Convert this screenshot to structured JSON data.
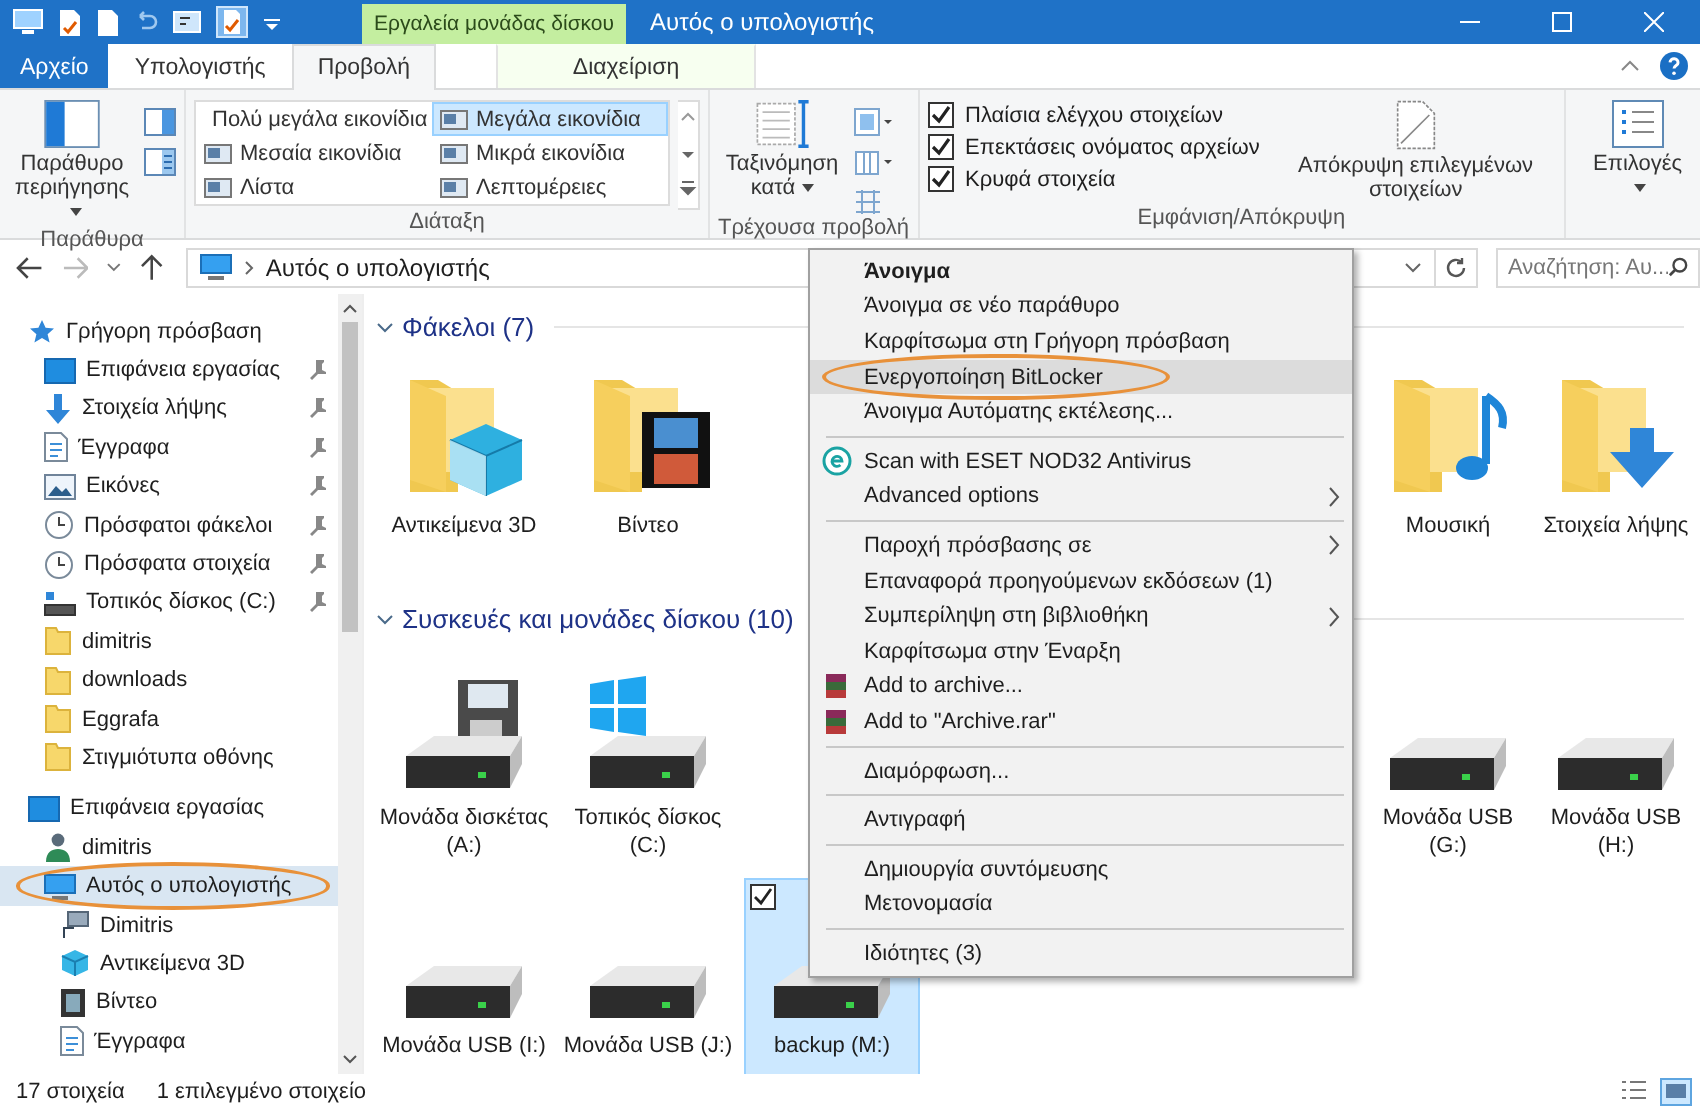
{
  "window": {
    "title": "Αυτός ο υπολογιστής",
    "context_tab": "Εργαλεία μονάδας δίσκου"
  },
  "tabs": [
    {
      "label": "Αρχείο",
      "kind": "file",
      "selected": false
    },
    {
      "label": "Υπολογιστής",
      "kind": "tab",
      "selected": false
    },
    {
      "label": "Προβολή",
      "kind": "tab",
      "selected": true
    },
    {
      "label": "Διαχείριση",
      "kind": "context",
      "selected": false
    }
  ],
  "ribbon": {
    "panes": {
      "button": "Παράθυρο περιήγησης",
      "label": "Παράθυρα"
    },
    "layout": {
      "label": "Διάταξη",
      "options": [
        {
          "label": "Πολύ μεγάλα εικονίδια",
          "selected": false
        },
        {
          "label": "Μεγάλα εικονίδια",
          "selected": true
        },
        {
          "label": "Μεσαία εικονίδια",
          "selected": false
        },
        {
          "label": "Μικρά εικονίδια",
          "selected": false
        },
        {
          "label": "Λίστα",
          "selected": false
        },
        {
          "label": "Λεπτομέρειες",
          "selected": false
        }
      ]
    },
    "current_view": {
      "button": "Ταξινόμηση κατά",
      "label": "Τρέχουσα προβολή"
    },
    "show_hide": {
      "label": "Εμφάνιση/Απόκρυψη",
      "checkboxes": [
        {
          "label": "Πλαίσια ελέγχου στοιχείων",
          "checked": true
        },
        {
          "label": "Επεκτάσεις ονόματος αρχείων",
          "checked": true
        },
        {
          "label": "Κρυφά στοιχεία",
          "checked": true
        }
      ],
      "hide_button": "Απόκρυψη επιλεγμένων στοιχείων"
    },
    "options": {
      "button": "Επιλογές"
    }
  },
  "address_bar": {
    "path": "Αυτός ο υπολογιστής",
    "search_placeholder": "Αναζήτηση: Αυ..."
  },
  "sidebar": {
    "items": [
      {
        "label": "Γρήγορη πρόσβαση",
        "kind": "star",
        "pinned": false,
        "selected": false,
        "circled": false,
        "children": [
          {
            "label": "Επιφάνεια εργασίας",
            "kind": "desktop",
            "pinned": true,
            "selected": false,
            "circled": false
          },
          {
            "label": "Στοιχεία λήψης",
            "kind": "download",
            "pinned": true,
            "selected": false,
            "circled": false
          },
          {
            "label": "Έγγραφα",
            "kind": "documents",
            "pinned": true,
            "selected": false,
            "circled": false
          },
          {
            "label": "Εικόνες",
            "kind": "pictures",
            "pinned": true,
            "selected": false,
            "circled": false
          },
          {
            "label": "Πρόσφατοι φάκελοι",
            "kind": "recent",
            "pinned": true,
            "selected": false,
            "circled": false
          },
          {
            "label": "Πρόσφατα στοιχεία",
            "kind": "recent",
            "pinned": true,
            "selected": false,
            "circled": false
          },
          {
            "label": "Τοπικός δίσκος (C:)",
            "kind": "drive",
            "pinned": true,
            "selected": false,
            "circled": false
          },
          {
            "label": "dimitris",
            "kind": "folder",
            "pinned": false,
            "selected": false,
            "circled": false
          },
          {
            "label": "downloads",
            "kind": "folder",
            "pinned": false,
            "selected": false,
            "circled": false
          },
          {
            "label": "Eggrafa",
            "kind": "folder",
            "pinned": false,
            "selected": false,
            "circled": false
          },
          {
            "label": "Στιγμιότυπα οθόνης",
            "kind": "folder",
            "pinned": false,
            "selected": false,
            "circled": false
          }
        ]
      },
      {
        "label": "Επιφάνεια εργασίας",
        "kind": "desktop",
        "pinned": false,
        "selected": false,
        "circled": false,
        "children": [
          {
            "label": "dimitris",
            "kind": "user",
            "pinned": false,
            "selected": false,
            "circled": false
          },
          {
            "label": "Αυτός ο υπολογιστής",
            "kind": "pc",
            "pinned": false,
            "selected": true,
            "circled": true,
            "children": [
              {
                "label": "Dimitris",
                "kind": "network",
                "pinned": false,
                "selected": false,
                "circled": false
              },
              {
                "label": "Αντικείμενα 3D",
                "kind": "cube",
                "pinned": false,
                "selected": false,
                "circled": false
              },
              {
                "label": "Βίντεο",
                "kind": "film",
                "pinned": false,
                "selected": false,
                "circled": false
              },
              {
                "label": "Έγγραφα",
                "kind": "documents",
                "pinned": false,
                "selected": false,
                "circled": false
              }
            ]
          }
        ]
      }
    ]
  },
  "content": {
    "sections": [
      {
        "title": "Φάκελοι (7)",
        "expanded": true,
        "rows": [
          {
            "left": [
              {
                "label": "Αντικείμενα 3D",
                "kind": "cube",
                "selected": false
              },
              {
                "label": "Βίντεο",
                "kind": "film",
                "selected": false
              }
            ],
            "right": [
              {
                "label": "Μουσική",
                "kind": "music",
                "selected": false
              },
              {
                "label": "Στοιχεία λήψης",
                "kind": "download",
                "selected": false
              }
            ]
          }
        ]
      },
      {
        "title": "Συσκευές και μονάδες δίσκου (10)",
        "expanded": true,
        "rows": [
          {
            "left": [
              {
                "label": "Μονάδα δισκέτας (A:)",
                "kind": "floppy",
                "selected": false
              },
              {
                "label": "Τοπικός δίσκος (C:)",
                "kind": "system",
                "selected": false
              }
            ],
            "right": [
              {
                "label": "Μονάδα USB (G:)",
                "kind": "drive",
                "selected": false
              },
              {
                "label": "Μονάδα USB (H:)",
                "kind": "drive",
                "selected": false
              }
            ]
          },
          {
            "left": [
              {
                "label": "Μονάδα USB (I:)",
                "kind": "drive",
                "selected": false
              },
              {
                "label": "Μονάδα USB (J:)",
                "kind": "drive",
                "selected": false
              },
              {
                "label": "backup (M:)",
                "kind": "drive",
                "selected": true
              }
            ]
          }
        ]
      }
    ]
  },
  "context_menu": {
    "items": [
      {
        "kind": "default",
        "label": "Άνοιγμα",
        "submenu": false,
        "highlighted": false,
        "circled": false
      },
      {
        "kind": "plain",
        "label": "Άνοιγμα σε νέο παράθυρο",
        "submenu": false,
        "highlighted": false,
        "circled": false
      },
      {
        "kind": "plain",
        "label": "Καρφίτσωμα στη Γρήγορη πρόσβαση",
        "submenu": false,
        "highlighted": false,
        "circled": false
      },
      {
        "kind": "plain",
        "label": "Ενεργοποίηση BitLocker",
        "submenu": false,
        "highlighted": true,
        "circled": true
      },
      {
        "kind": "plain",
        "label": "Άνοιγμα Αυτόματης εκτέλεσης...",
        "submenu": false,
        "highlighted": false,
        "circled": false
      },
      {
        "kind": "separator"
      },
      {
        "kind": "antivirus",
        "label": "Scan with ESET NOD32 Antivirus",
        "submenu": false,
        "highlighted": false,
        "circled": false
      },
      {
        "kind": "plain",
        "label": "Advanced options",
        "submenu": true,
        "highlighted": false,
        "circled": false
      },
      {
        "kind": "separator"
      },
      {
        "kind": "plain",
        "label": "Παροχή πρόσβασης σε",
        "submenu": true,
        "highlighted": false,
        "circled": false
      },
      {
        "kind": "plain",
        "label": "Επαναφορά προηγούμενων εκδόσεων (1)",
        "submenu": false,
        "highlighted": false,
        "circled": false
      },
      {
        "kind": "plain",
        "label": "Συμπερίληψη στη βιβλιοθήκη",
        "submenu": true,
        "highlighted": false,
        "circled": false
      },
      {
        "kind": "plain",
        "label": "Καρφίτσωμα στην Έναρξη",
        "submenu": false,
        "highlighted": false,
        "circled": false
      },
      {
        "kind": "archive",
        "label": "Add to archive...",
        "submenu": false,
        "highlighted": false,
        "circled": false
      },
      {
        "kind": "archive",
        "label": "Add to \"Archive.rar\"",
        "submenu": false,
        "highlighted": false,
        "circled": false
      },
      {
        "kind": "separator"
      },
      {
        "kind": "plain",
        "label": "Διαμόρφωση...",
        "submenu": false,
        "highlighted": false,
        "circled": false
      },
      {
        "kind": "separator"
      },
      {
        "kind": "plain",
        "label": "Αντιγραφή",
        "submenu": false,
        "highlighted": false,
        "circled": false
      },
      {
        "kind": "separator"
      },
      {
        "kind": "plain",
        "label": "Δημιουργία συντόμευσης",
        "submenu": false,
        "highlighted": false,
        "circled": false
      },
      {
        "kind": "plain",
        "label": "Μετονομασία",
        "submenu": false,
        "highlighted": false,
        "circled": false
      },
      {
        "kind": "separator"
      },
      {
        "kind": "plain",
        "label": "Ιδιότητες (3)",
        "submenu": false,
        "highlighted": false,
        "circled": false
      }
    ]
  },
  "status_bar": {
    "count": "17 στοιχεία",
    "selection": "1 επιλεγμένο στοιχείο"
  }
}
